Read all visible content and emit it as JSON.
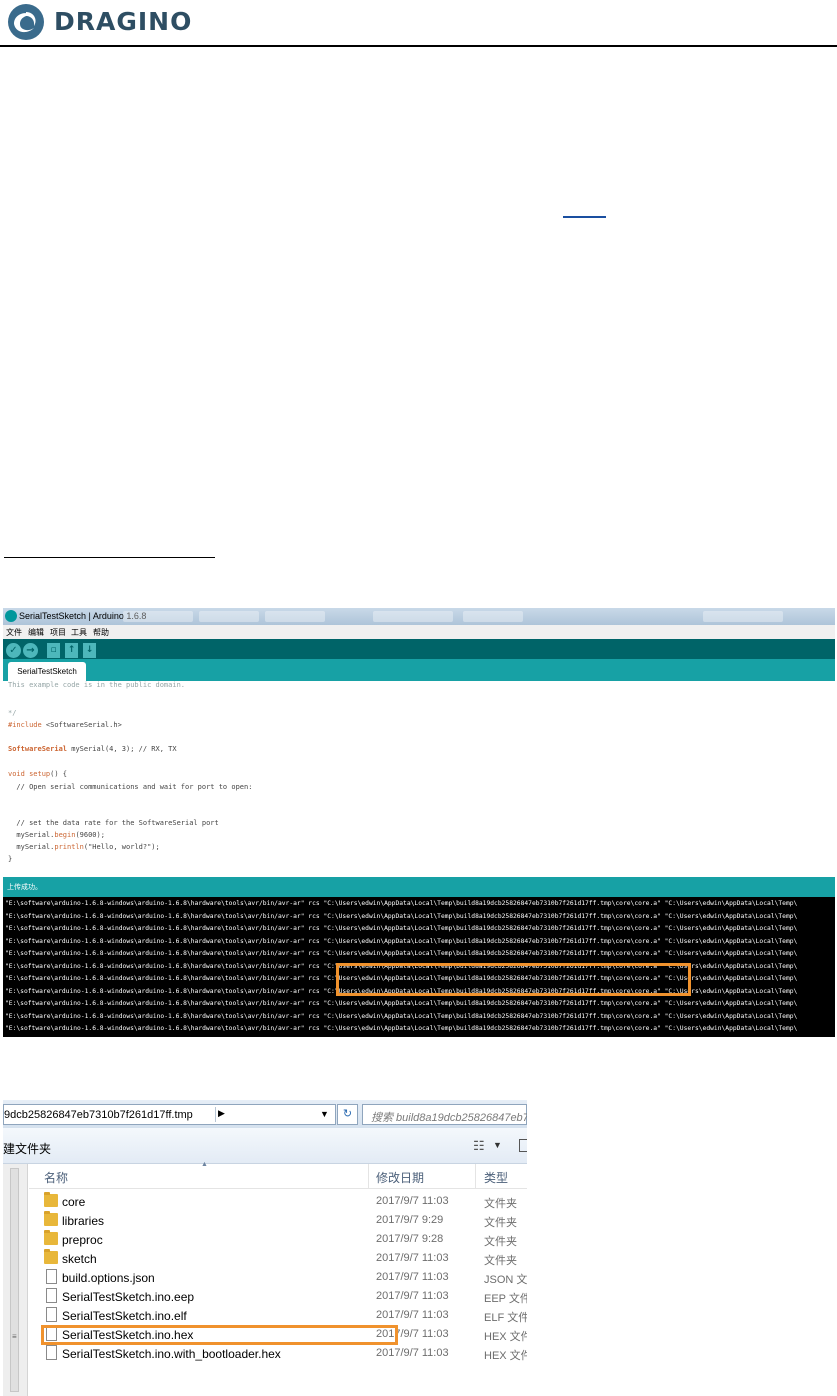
{
  "header": {
    "brand": "DRAGINO",
    "brand_colors": {
      "icon": "#3a6b8c",
      "text": "#2e4e63"
    }
  },
  "ide": {
    "title": "SerialTestSketch | Arduino 1.6.8",
    "menu": [
      "文件",
      "编辑",
      "项目",
      "工具",
      "帮助"
    ],
    "toolbar_icons": [
      "verify-icon",
      "upload-icon",
      "new-icon",
      "open-icon",
      "save-icon"
    ],
    "tab_label": "SerialTestSketch",
    "code": {
      "l1": "This example code is in the public domain.",
      "l2": "*/",
      "l3_kw": "#include",
      "l3_rest": " <SoftwareSerial.h>",
      "l4_type": "SoftwareSerial",
      "l4_rest": " mySerial(4, 3); // RX, TX",
      "l5_kw": "void",
      "l5_fn": " setup",
      "l5_rest": "() {",
      "l6": "  // Open serial communications and wait for port to open:",
      "l7": "  // set the data rate for the SoftwareSerial port",
      "l8_obj": "  mySerial.",
      "l8_fn": "begin",
      "l8_rest": "(9600);",
      "l9_obj": "  mySerial.",
      "l9_fn": "println",
      "l9_rest": "(\"Hello, world?\");",
      "l10": "}"
    },
    "status_text": "上传成功。",
    "console_line": "\"E:\\software\\arduino-1.6.8-windows\\arduino-1.6.8\\hardware\\tools\\avr/bin/avr-ar\" rcs  \"C:\\Users\\edwin\\AppData\\Local\\Temp\\build8a19dcb25826847eb7310b7f261d17ff.tmp\\core\\core.a\" \"C:\\Users\\edwin\\AppData\\Local\\Temp\\"
  },
  "explorer": {
    "address": "9dcb25826847eb7310b7f261d17ff.tmp",
    "search_placeholder": "搜索 build8a19dcb25826847eb7310b7f261d17ff.tmp",
    "cmd_label": "建文件夹",
    "columns": {
      "name": "名称",
      "date": "修改日期",
      "type": "类型"
    },
    "rows": [
      {
        "name": "core",
        "date": "2017/9/7 11:03",
        "type": "文件夹",
        "kind": "folder"
      },
      {
        "name": "libraries",
        "date": "2017/9/7 9:29",
        "type": "文件夹",
        "kind": "folder"
      },
      {
        "name": "preproc",
        "date": "2017/9/7 9:28",
        "type": "文件夹",
        "kind": "folder"
      },
      {
        "name": "sketch",
        "date": "2017/9/7 11:03",
        "type": "文件夹",
        "kind": "folder"
      },
      {
        "name": "build.options.json",
        "date": "2017/9/7 11:03",
        "type": "JSON 文",
        "kind": "file"
      },
      {
        "name": "SerialTestSketch.ino.eep",
        "date": "2017/9/7 11:03",
        "type": "EEP 文件",
        "kind": "file"
      },
      {
        "name": "SerialTestSketch.ino.elf",
        "date": "2017/9/7 11:03",
        "type": "ELF 文件",
        "kind": "file"
      },
      {
        "name": "SerialTestSketch.ino.hex",
        "date": "2017/9/7 11:03",
        "type": "HEX 文件",
        "kind": "file"
      },
      {
        "name": "SerialTestSketch.ino.with_bootloader.hex",
        "date": "2017/9/7 11:03",
        "type": "HEX 文件",
        "kind": "file"
      }
    ]
  },
  "accent_colors": {
    "highlight_box": "#f0922d",
    "arduino_teal": "#00979c"
  }
}
